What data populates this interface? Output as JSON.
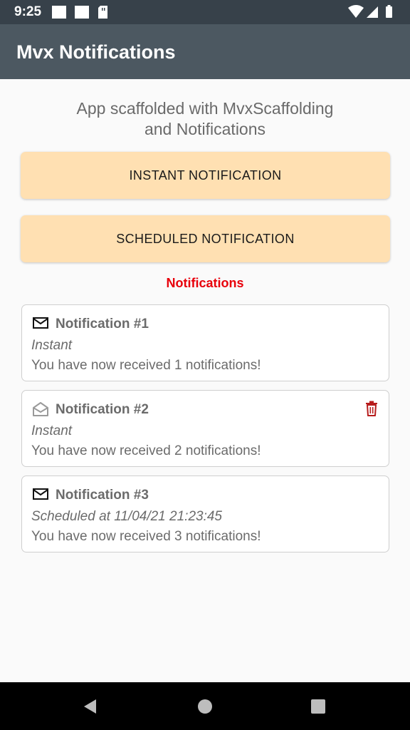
{
  "status_bar": {
    "time": "9:25",
    "left_icons": [
      "notification-square-icon",
      "notification-square-icon",
      "sd-card-icon"
    ],
    "right_icons": [
      "wifi-icon",
      "cell-signal-icon",
      "battery-icon"
    ]
  },
  "app_bar": {
    "title": "Mvx Notifications"
  },
  "main": {
    "subtitle_line1": "App scaffolded with MvxScaffolding",
    "subtitle_line2": "and Notifications",
    "instant_button": "INSTANT NOTIFICATION",
    "scheduled_button": "SCHEDULED NOTIFICATION",
    "section_title": "Notifications"
  },
  "notifications": [
    {
      "title": "Notification #1",
      "type": "Instant",
      "message": "You have now received 1 notifications!",
      "icon": "envelope-closed-icon",
      "read": false
    },
    {
      "title": "Notification #2",
      "type": "Instant",
      "message": "You have now received 2 notifications!",
      "icon": "envelope-open-icon",
      "read": true
    },
    {
      "title": "Notification #3",
      "type": "Scheduled at 11/04/21 21:23:45",
      "message": "You have now received 3 notifications!",
      "icon": "envelope-closed-icon",
      "read": false
    }
  ],
  "colors": {
    "status_bar": "#37414a",
    "app_bar": "#4c5861",
    "button_background": "#ffe0b2",
    "section_title": "#e8000b",
    "delete_icon": "#b71c1c"
  },
  "nav_bar": {
    "icons": [
      "back-icon",
      "home-icon",
      "recents-icon"
    ]
  }
}
